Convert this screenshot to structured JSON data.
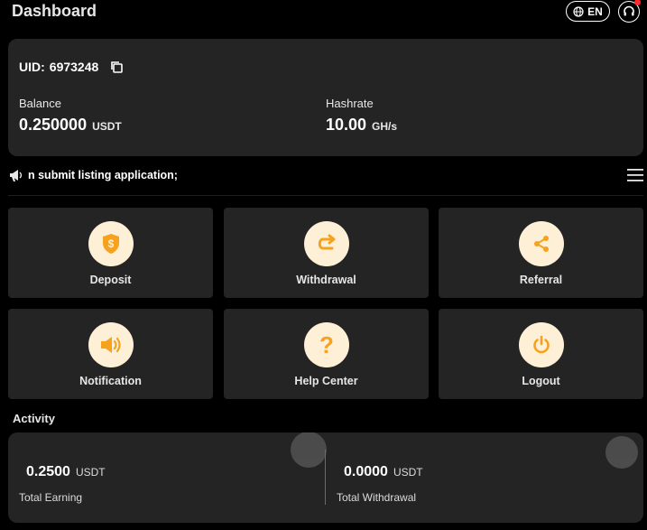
{
  "header": {
    "title": "Dashboard",
    "language_label": "EN",
    "language_icon": "globe-icon",
    "support_icon": "headset-icon",
    "notification_dot_color": "#ff2a2a"
  },
  "account": {
    "uid_label": "UID:",
    "uid_value": "6973248",
    "balance": {
      "label": "Balance",
      "value": "0.250000",
      "unit": "USDT"
    },
    "hashrate": {
      "label": "Hashrate",
      "value": "10.00",
      "unit": "GH/s"
    }
  },
  "announcement": {
    "text": "n submit listing application;"
  },
  "actions": [
    {
      "label": "Deposit",
      "icon": "dollar-shield-icon"
    },
    {
      "label": "Withdrawal",
      "icon": "withdraw-arrow-icon"
    },
    {
      "label": "Referral",
      "icon": "share-icon"
    },
    {
      "label": "Notification",
      "icon": "speaker-icon"
    },
    {
      "label": "Help Center",
      "icon": "question-icon"
    },
    {
      "label": "Logout",
      "icon": "power-icon"
    }
  ],
  "activity": {
    "title": "Activity",
    "total_earning": {
      "value": "0.2500",
      "unit": "USDT",
      "label": "Total Earning"
    },
    "total_withdrawal": {
      "value": "0.0000",
      "unit": "USDT",
      "label": "Total Withdrawal"
    }
  },
  "colors": {
    "accent": "#f6a21e",
    "icon_background": "#fdf0d6",
    "card_background": "#242424",
    "page_background": "#000000"
  }
}
